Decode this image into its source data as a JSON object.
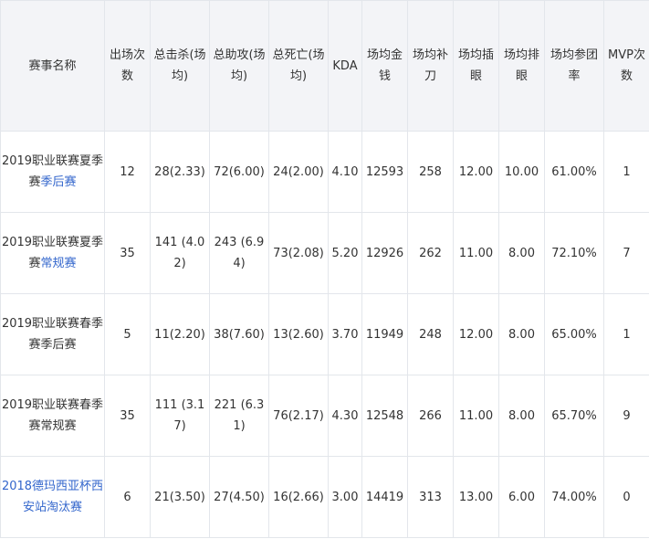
{
  "columns": [
    "赛事名称",
    "出场次数",
    "总击杀(场均)",
    "总助攻(场均)",
    "总死亡(场均)",
    "KDA",
    "场均金钱",
    "场均补刀",
    "场均插眼",
    "场均排眼",
    "场均参团率",
    "MVP次数"
  ],
  "rows": [
    {
      "event": {
        "plain": "2019职业联赛夏季赛",
        "link": "季后赛"
      },
      "appearances": "12",
      "kills": "28(2.33)",
      "assists": "72(6.00)",
      "deaths": "24(2.00)",
      "kda": "4.10",
      "gold": "12593",
      "cs": "258",
      "wards_placed": "12.00",
      "wards_cleared": "10.00",
      "participation": "61.00%",
      "mvp": "1"
    },
    {
      "event": {
        "plain": "2019职业联赛夏季赛",
        "link": "常规赛"
      },
      "appearances": "35",
      "kills": "141 (4.02)",
      "assists": "243 (6.94)",
      "deaths": "73(2.08)",
      "kda": "5.20",
      "gold": "12926",
      "cs": "262",
      "wards_placed": "11.00",
      "wards_cleared": "8.00",
      "participation": "72.10%",
      "mvp": "7"
    },
    {
      "event": {
        "plain": "2019职业联赛春季赛季后赛",
        "link": ""
      },
      "appearances": "5",
      "kills": "11(2.20)",
      "assists": "38(7.60)",
      "deaths": "13(2.60)",
      "kda": "3.70",
      "gold": "11949",
      "cs": "248",
      "wards_placed": "12.00",
      "wards_cleared": "8.00",
      "participation": "65.00%",
      "mvp": "1"
    },
    {
      "event": {
        "plain": "2019职业联赛春季赛常规赛",
        "link": ""
      },
      "appearances": "35",
      "kills": "111 (3.17)",
      "assists": "221 (6.31)",
      "deaths": "76(2.17)",
      "kda": "4.30",
      "gold": "12548",
      "cs": "266",
      "wards_placed": "11.00",
      "wards_cleared": "8.00",
      "participation": "65.70%",
      "mvp": "9"
    },
    {
      "event": {
        "plain": "",
        "link": "2018德玛西亚杯西安站淘汰赛"
      },
      "appearances": "6",
      "kills": "21(3.50)",
      "assists": "27(4.50)",
      "deaths": "16(2.66)",
      "kda": "3.00",
      "gold": "14419",
      "cs": "313",
      "wards_placed": "13.00",
      "wards_cleared": "6.00",
      "participation": "74.00%",
      "mvp": "0"
    }
  ],
  "colors": {
    "link": "#3366cc",
    "text": "#333333",
    "header_bg": "#f3f4f7",
    "border": "#e3e6eb"
  }
}
